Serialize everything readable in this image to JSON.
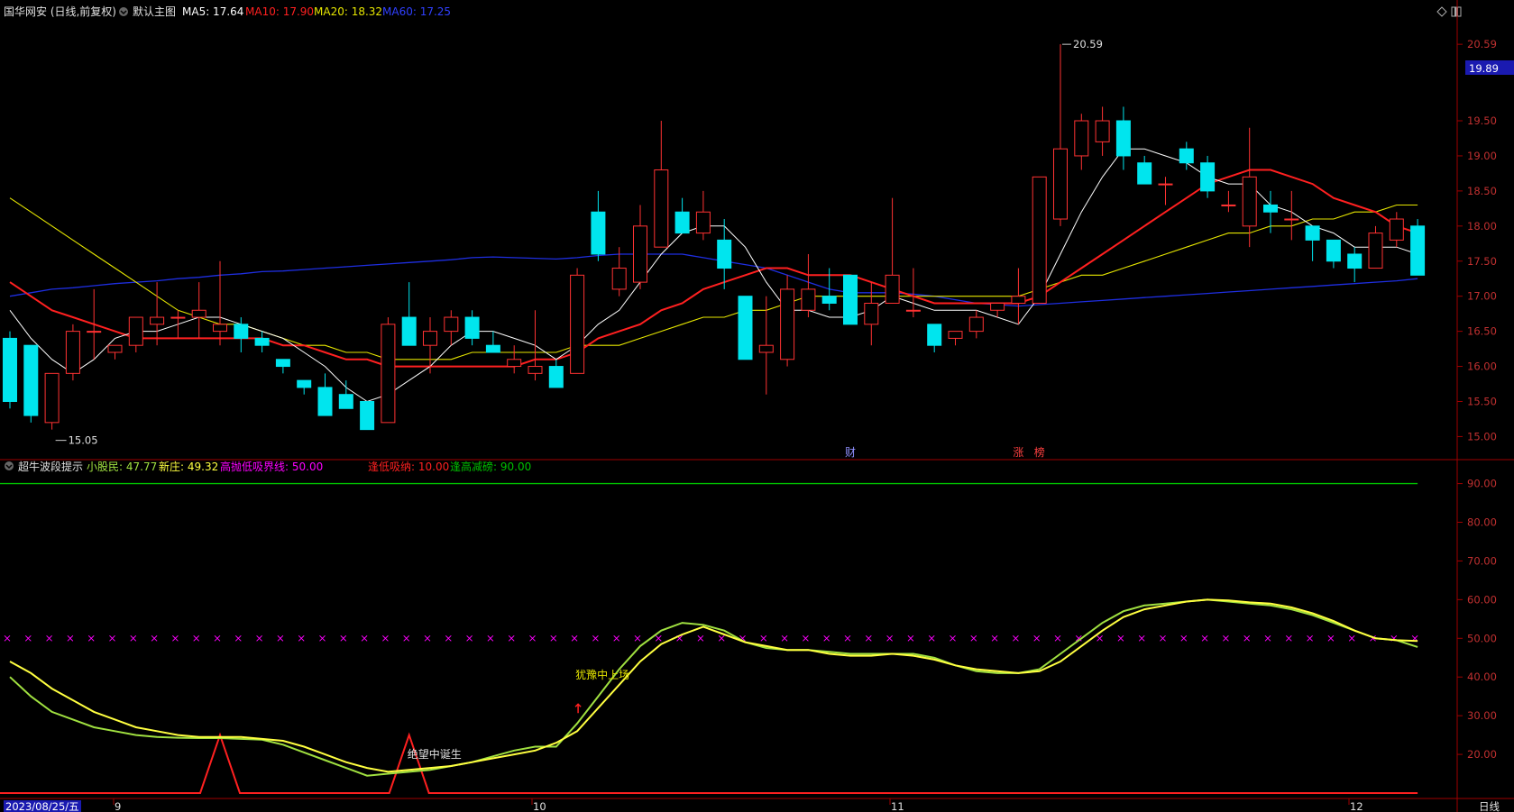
{
  "colors": {
    "bg": "#000000",
    "frame": "#a00000",
    "up": "#ff3232",
    "down": "#00e5ee",
    "ma5": "#ffffff",
    "ma10": "#ff2020",
    "ma20": "#e6e600",
    "ma60": "#1e2ee0",
    "xiaogu": "#a0e040",
    "xinzhuang": "#ffff40",
    "boundary": "#ff00ff",
    "sell_line": "#00c000",
    "buy_line": "#ff2020"
  },
  "main_legend": {
    "title": "国华网安 (日线,前复权)",
    "template": "默认主图",
    "ma5_label": "MA5: 17.64",
    "ma10_label": "MA10: 17.90",
    "ma20_label": "MA20: 18.32",
    "ma60_label": "MA60: 17.25"
  },
  "sub_legend": {
    "title": "超牛波段提示",
    "xiaogu_label": "小股民: 47.77",
    "xinzhuang_label": "新庄: 49.32",
    "boundary_label": "高抛低吸界线: 50.00",
    "buy_label": "逢低吸纳: 10.00",
    "sell_label": "逢高减磅: 90.00"
  },
  "price_axis": [
    "20.59",
    "19.50",
    "19.00",
    "18.50",
    "18.00",
    "17.50",
    "17.00",
    "16.50",
    "16.00",
    "15.50",
    "15.00"
  ],
  "current_price": "19.89",
  "osc_axis": [
    "90.00",
    "80.00",
    "70.00",
    "60.00",
    "50.00",
    "40.00",
    "30.00",
    "20.00"
  ],
  "date_axis": {
    "start": "2023/08/25/五",
    "months": [
      "9",
      "10",
      "11",
      "12"
    ],
    "period": "日线"
  },
  "annotations": {
    "high": "20.59",
    "low": "15.05",
    "events": [
      "财",
      "涨",
      "榜"
    ],
    "signal_1": "绝望中诞生",
    "signal_2": "犹豫中上场"
  },
  "chart_data": [
    {
      "type": "candlestick",
      "title": "国华网安 (日线,前复权)",
      "note": "open, high, low, close per trading day from 2023-08-25",
      "candles": [
        [
          16.4,
          16.5,
          15.4,
          15.5
        ],
        [
          16.3,
          16.3,
          15.2,
          15.3
        ],
        [
          15.2,
          15.9,
          15.1,
          15.9
        ],
        [
          15.9,
          16.6,
          15.8,
          16.5
        ],
        [
          16.5,
          17.1,
          16.1,
          16.5
        ],
        [
          16.2,
          16.3,
          16.1,
          16.3
        ],
        [
          16.3,
          16.7,
          16.2,
          16.7
        ],
        [
          16.6,
          17.2,
          16.3,
          16.7
        ],
        [
          16.7,
          16.8,
          16.4,
          16.7
        ],
        [
          16.7,
          17.2,
          16.4,
          16.8
        ],
        [
          16.5,
          17.5,
          16.3,
          16.6
        ],
        [
          16.6,
          16.7,
          16.2,
          16.4
        ],
        [
          16.4,
          16.5,
          16.2,
          16.3
        ],
        [
          16.1,
          16.1,
          15.9,
          16.0
        ],
        [
          15.8,
          15.8,
          15.6,
          15.7
        ],
        [
          15.7,
          15.9,
          15.3,
          15.3
        ],
        [
          15.6,
          15.8,
          15.4,
          15.4
        ],
        [
          15.5,
          15.5,
          15.1,
          15.1
        ],
        [
          15.2,
          16.7,
          15.2,
          16.6
        ],
        [
          16.7,
          17.2,
          16.3,
          16.3
        ],
        [
          16.3,
          16.7,
          15.9,
          16.5
        ],
        [
          16.5,
          16.8,
          16.3,
          16.7
        ],
        [
          16.7,
          16.8,
          16.3,
          16.4
        ],
        [
          16.3,
          16.5,
          16.2,
          16.2
        ],
        [
          16.0,
          16.3,
          15.9,
          16.1
        ],
        [
          15.9,
          16.8,
          15.8,
          16.0
        ],
        [
          16.0,
          16.1,
          15.7,
          15.7
        ],
        [
          15.9,
          17.4,
          15.9,
          17.3
        ],
        [
          18.2,
          18.5,
          17.5,
          17.6
        ],
        [
          17.1,
          17.7,
          17.0,
          17.4
        ],
        [
          17.2,
          18.3,
          17.1,
          18.0
        ],
        [
          17.7,
          19.5,
          17.7,
          18.8
        ],
        [
          18.2,
          18.4,
          17.9,
          17.9
        ],
        [
          17.9,
          18.5,
          17.8,
          18.2
        ],
        [
          17.8,
          18.1,
          17.1,
          17.4
        ],
        [
          17.0,
          17.0,
          16.1,
          16.1
        ],
        [
          16.2,
          17.0,
          15.6,
          16.3
        ],
        [
          16.1,
          17.3,
          16.0,
          17.1
        ],
        [
          16.8,
          17.6,
          16.7,
          17.1
        ],
        [
          17.0,
          17.4,
          16.8,
          16.9
        ],
        [
          17.3,
          17.3,
          16.6,
          16.6
        ],
        [
          16.6,
          17.2,
          16.3,
          16.9
        ],
        [
          16.9,
          18.4,
          16.9,
          17.3
        ],
        [
          16.8,
          17.4,
          16.7,
          16.8
        ],
        [
          16.6,
          16.6,
          16.2,
          16.3
        ],
        [
          16.4,
          16.5,
          16.3,
          16.5
        ],
        [
          16.5,
          16.8,
          16.4,
          16.7
        ],
        [
          16.8,
          16.9,
          16.7,
          16.9
        ],
        [
          16.9,
          17.4,
          16.6,
          17.0
        ],
        [
          16.9,
          18.7,
          16.9,
          18.7
        ],
        [
          18.1,
          20.59,
          18.0,
          19.1
        ],
        [
          19.0,
          19.6,
          18.8,
          19.5
        ],
        [
          19.2,
          19.7,
          19.0,
          19.5
        ],
        [
          19.5,
          19.7,
          18.8,
          19.0
        ],
        [
          18.9,
          19.0,
          18.6,
          18.6
        ],
        [
          18.6,
          18.7,
          18.3,
          18.6
        ],
        [
          19.1,
          19.2,
          18.8,
          18.9
        ],
        [
          18.9,
          19.0,
          18.4,
          18.5
        ],
        [
          18.3,
          18.5,
          18.2,
          18.3
        ],
        [
          18.0,
          19.4,
          17.7,
          18.7
        ],
        [
          18.3,
          18.5,
          17.9,
          18.2
        ],
        [
          18.1,
          18.5,
          17.8,
          18.1
        ],
        [
          18.0,
          18.0,
          17.5,
          17.8
        ],
        [
          17.8,
          17.8,
          17.4,
          17.5
        ],
        [
          17.6,
          17.7,
          17.2,
          17.4
        ],
        [
          17.4,
          18.0,
          17.4,
          17.9
        ],
        [
          17.8,
          18.2,
          17.7,
          18.1
        ],
        [
          18.0,
          18.1,
          17.3,
          17.3
        ]
      ],
      "ma5": [
        16.8,
        16.4,
        16.1,
        15.9,
        16.1,
        16.4,
        16.5,
        16.5,
        16.6,
        16.7,
        16.7,
        16.6,
        16.5,
        16.4,
        16.2,
        16.0,
        15.7,
        15.5,
        15.6,
        15.8,
        16.0,
        16.3,
        16.5,
        16.5,
        16.4,
        16.3,
        16.1,
        16.3,
        16.6,
        16.8,
        17.2,
        17.6,
        17.9,
        18.0,
        18.0,
        17.7,
        17.2,
        16.8,
        16.8,
        16.7,
        16.7,
        16.8,
        17.0,
        16.9,
        16.8,
        16.8,
        16.8,
        16.7,
        16.6,
        17.0,
        17.6,
        18.2,
        18.7,
        19.1,
        19.1,
        19.0,
        18.9,
        18.7,
        18.6,
        18.6,
        18.3,
        18.2,
        18.0,
        17.9,
        17.7,
        17.7,
        17.7,
        17.6
      ],
      "ma10": [
        17.2,
        17.0,
        16.8,
        16.7,
        16.6,
        16.5,
        16.4,
        16.4,
        16.4,
        16.4,
        16.4,
        16.4,
        16.4,
        16.3,
        16.3,
        16.2,
        16.1,
        16.1,
        16.0,
        16.0,
        16.0,
        16.0,
        16.0,
        16.0,
        16.0,
        16.1,
        16.1,
        16.2,
        16.4,
        16.5,
        16.6,
        16.8,
        16.9,
        17.1,
        17.2,
        17.3,
        17.4,
        17.4,
        17.3,
        17.3,
        17.3,
        17.2,
        17.1,
        17.0,
        16.9,
        16.9,
        16.9,
        16.9,
        16.9,
        17.0,
        17.2,
        17.4,
        17.6,
        17.8,
        18.0,
        18.2,
        18.4,
        18.6,
        18.7,
        18.8,
        18.8,
        18.7,
        18.6,
        18.4,
        18.3,
        18.2,
        18.0,
        17.9
      ],
      "ma20": [
        18.4,
        18.2,
        18.0,
        17.8,
        17.6,
        17.4,
        17.2,
        17.0,
        16.8,
        16.7,
        16.6,
        16.6,
        16.5,
        16.4,
        16.3,
        16.3,
        16.2,
        16.2,
        16.1,
        16.1,
        16.1,
        16.1,
        16.2,
        16.2,
        16.2,
        16.2,
        16.2,
        16.3,
        16.3,
        16.3,
        16.4,
        16.5,
        16.6,
        16.7,
        16.7,
        16.8,
        16.8,
        16.9,
        17.0,
        17.0,
        17.0,
        17.0,
        17.0,
        17.0,
        17.0,
        17.0,
        17.0,
        17.0,
        17.0,
        17.1,
        17.2,
        17.3,
        17.3,
        17.4,
        17.5,
        17.6,
        17.7,
        17.8,
        17.9,
        17.9,
        18.0,
        18.0,
        18.1,
        18.1,
        18.2,
        18.2,
        18.3,
        18.3
      ],
      "ma60": [
        17.0,
        17.05,
        17.1,
        17.12,
        17.15,
        17.18,
        17.2,
        17.22,
        17.25,
        17.27,
        17.3,
        17.32,
        17.35,
        17.36,
        17.38,
        17.4,
        17.42,
        17.44,
        17.46,
        17.48,
        17.5,
        17.52,
        17.55,
        17.56,
        17.55,
        17.54,
        17.53,
        17.55,
        17.58,
        17.6,
        17.6,
        17.6,
        17.6,
        17.55,
        17.5,
        17.45,
        17.4,
        17.3,
        17.2,
        17.1,
        17.05,
        17.05,
        17.05,
        17.03,
        17.0,
        16.95,
        16.9,
        16.88,
        16.86,
        16.88,
        16.9,
        16.92,
        16.94,
        16.96,
        16.98,
        17.0,
        17.02,
        17.04,
        17.06,
        17.08,
        17.1,
        17.12,
        17.14,
        17.16,
        17.18,
        17.2,
        17.22,
        17.25
      ],
      "events": [
        {
          "index": 40,
          "label": "财"
        },
        {
          "index": 48,
          "label": "涨"
        },
        {
          "index": 49,
          "label": "榜"
        }
      ],
      "ylim": [
        14.8,
        20.9
      ]
    },
    {
      "type": "line",
      "title": "超牛波段提示",
      "series": [
        {
          "name": "小股民",
          "values": [
            40,
            35,
            31,
            29,
            27,
            26,
            25,
            24.5,
            24.3,
            24.2,
            24.2,
            24.0,
            23.8,
            22.5,
            20.5,
            18.5,
            16.5,
            14.5,
            15.0,
            15.5,
            16.0,
            17.0,
            18.0,
            19.5,
            21.0,
            22.0,
            22.0,
            28.0,
            35.0,
            42.0,
            48.0,
            52.0,
            54.0,
            53.5,
            52.0,
            49.0,
            47.5,
            47.0,
            47.0,
            46.5,
            46.0,
            46.0,
            46.0,
            46.0,
            45.0,
            43.0,
            41.5,
            41.0,
            41.0,
            42.0,
            46.0,
            50.0,
            54.0,
            57.0,
            58.5,
            59.0,
            59.5,
            60.0,
            59.5,
            59.0,
            58.5,
            57.5,
            56.0,
            54.0,
            52.0,
            50.0,
            49.5,
            47.77
          ]
        },
        {
          "name": "新庄",
          "values": [
            44,
            41,
            37,
            34,
            31,
            29,
            27,
            26,
            25,
            24.5,
            24.5,
            24.5,
            24.0,
            23.5,
            22.0,
            20.0,
            18.0,
            16.5,
            15.5,
            16.0,
            16.5,
            17.0,
            18.0,
            19.0,
            20.0,
            21.0,
            23.0,
            26.0,
            32.0,
            38.0,
            44.0,
            48.5,
            51.0,
            53.0,
            51.0,
            49.0,
            48.0,
            47.0,
            47.0,
            46.0,
            45.5,
            45.5,
            46.0,
            45.5,
            44.5,
            43.0,
            42.0,
            41.5,
            41.0,
            41.5,
            44.0,
            48.0,
            52.0,
            55.5,
            57.5,
            58.5,
            59.5,
            60.0,
            59.8,
            59.3,
            59.0,
            58.0,
            56.5,
            54.5,
            52.0,
            50.0,
            49.5,
            49.32
          ]
        },
        {
          "name": "高抛低吸界线",
          "values": [
            50
          ]
        },
        {
          "name": "逢低吸纳",
          "values": [
            10
          ]
        },
        {
          "name": "逢高减磅",
          "values": [
            90
          ]
        }
      ],
      "signal_spikes": [
        {
          "index": 10,
          "value": 25
        },
        {
          "index": 19,
          "value": 25
        }
      ],
      "markers": [
        {
          "index": 19,
          "label": "绝望中诞生"
        },
        {
          "index": 27,
          "label": "犹豫中上场"
        }
      ],
      "ylim": [
        10,
        92
      ]
    }
  ]
}
